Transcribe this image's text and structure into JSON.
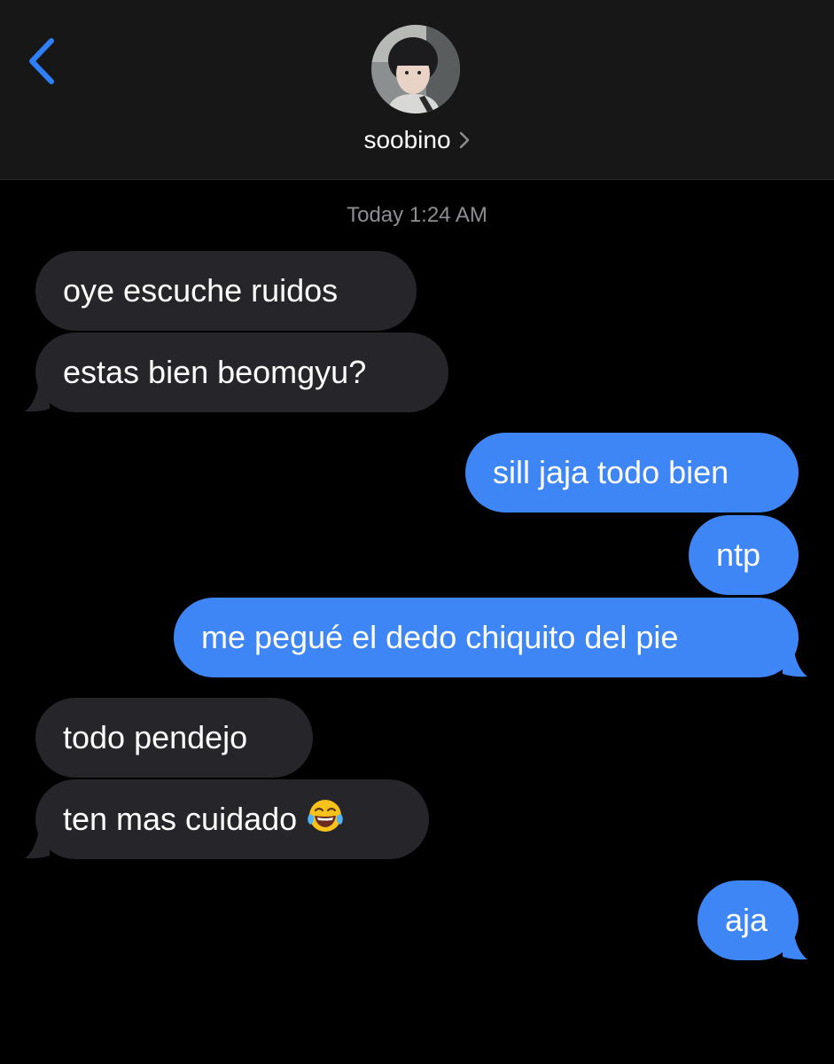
{
  "header": {
    "contact_name": "soobino",
    "back_icon": "chevron-left-icon",
    "details_icon": "chevron-right-icon",
    "avatar_icon": "avatar"
  },
  "conversation": {
    "timestamp": "Today 1:24 AM",
    "messages": [
      {
        "from": "them",
        "text": "oye escuche ruidos"
      },
      {
        "from": "them",
        "text": "estas bien beomgyu?"
      },
      {
        "from": "me",
        "text": "sill jaja todo bien"
      },
      {
        "from": "me",
        "text": "ntp"
      },
      {
        "from": "me",
        "text": "me pegué el dedo chiquito del pie"
      },
      {
        "from": "them",
        "text": "todo pendejo"
      },
      {
        "from": "them",
        "text": "ten mas cuidado",
        "emoji": "face-with-tears-of-joy-icon"
      },
      {
        "from": "me",
        "text": "aja"
      }
    ]
  },
  "colors": {
    "background": "#000000",
    "header_background": "#171717",
    "incoming_bubble": "#26252a",
    "outgoing_bubble": "#3e86f5",
    "accent": "#2f7ff6",
    "timestamp_text": "#8e8e93"
  }
}
